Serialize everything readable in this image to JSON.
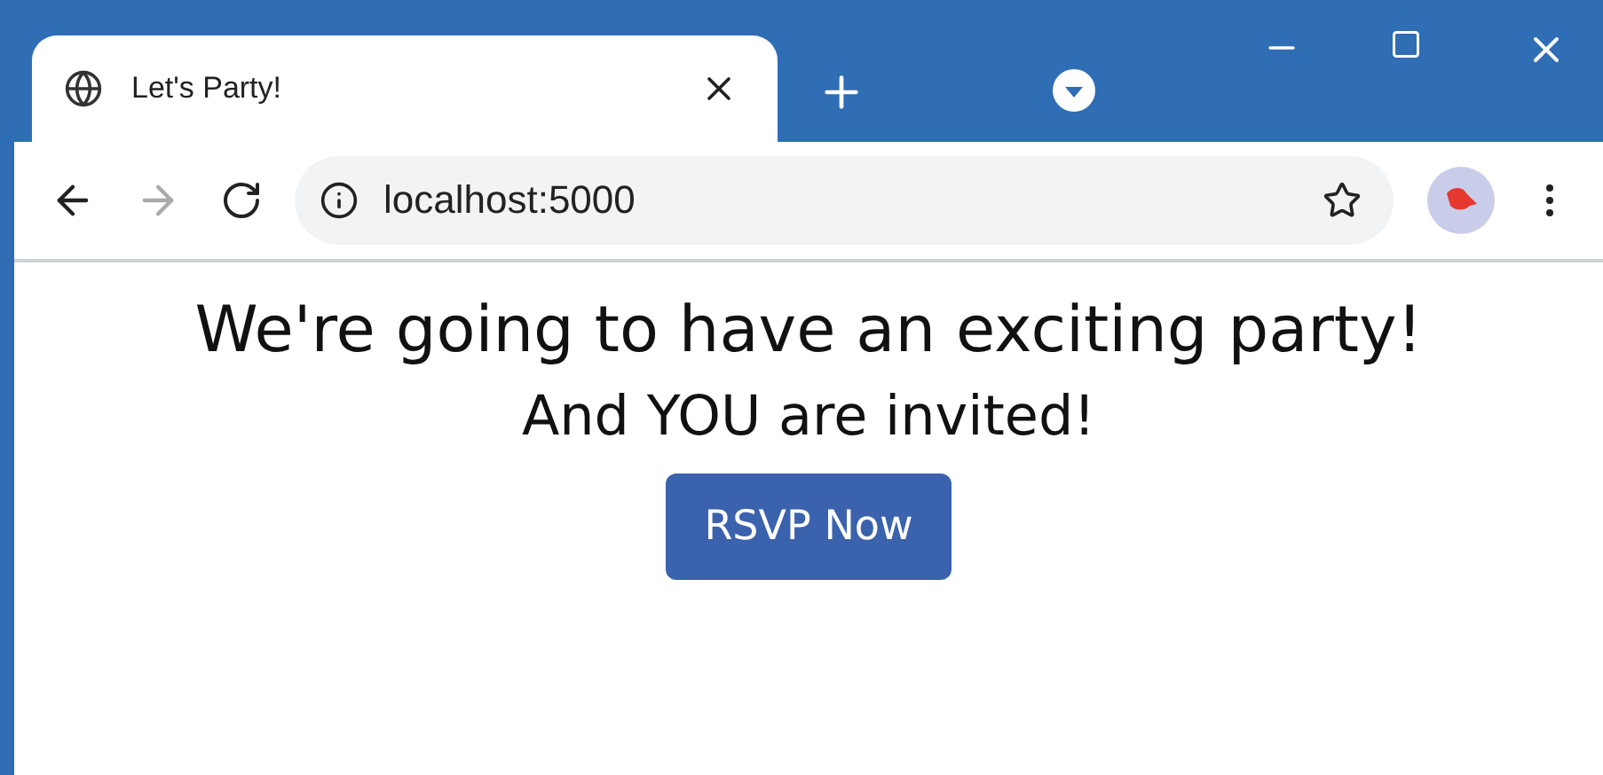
{
  "window": {
    "tabs": [
      {
        "title": "Let's Party!",
        "selected": true
      }
    ]
  },
  "toolbar": {
    "back": {
      "disabled": false
    },
    "forward": {
      "disabled": true
    },
    "address": "localhost:5000"
  },
  "page": {
    "heading": "We're going to have an exciting party!",
    "subheading": "And YOU are invited!",
    "button": "RSVP Now"
  }
}
